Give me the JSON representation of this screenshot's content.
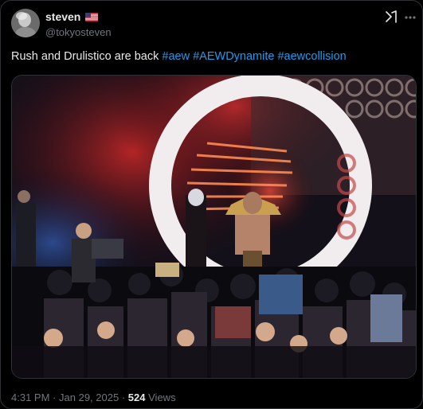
{
  "user": {
    "display_name": "steven",
    "handle": "@tokyosteven",
    "flag_icon": "us-flag-icon"
  },
  "tweet": {
    "text": "Rush and Drulistico are back",
    "hashtags": [
      "#aew",
      "#AEWDynamite",
      "#aewcollision"
    ]
  },
  "footer": {
    "time": "4:31 PM",
    "separator": "·",
    "date": "Jan 29, 2025",
    "views_count": "524",
    "views_label": "Views"
  },
  "icons": {
    "grok": "grok-icon",
    "more": "more-icon"
  },
  "colors": {
    "link": "#1d9bf0",
    "secondary_text": "#71767b",
    "primary_text": "#e7e9ea",
    "border": "#2f3336"
  }
}
